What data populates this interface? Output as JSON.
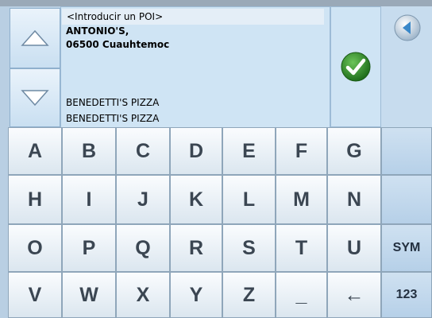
{
  "input": {
    "text": "<Introducir un POI>"
  },
  "results": {
    "highlighted": {
      "line1": "ANTONIO'S,",
      "line2": "06500 Cuauhtemoc"
    },
    "next": {
      "line1": "BENEDETTI'S PIZZA",
      "line2": "BENEDETTI'S PIZZA"
    }
  },
  "keyboard": {
    "rows": [
      [
        "A",
        "B",
        "C",
        "D",
        "E",
        "F",
        "G"
      ],
      [
        "H",
        "I",
        "J",
        "K",
        "L",
        "M",
        "N"
      ],
      [
        "O",
        "P",
        "Q",
        "R",
        "S",
        "T",
        "U"
      ],
      [
        "V",
        "W",
        "X",
        "Y",
        "Z",
        "_",
        "←"
      ]
    ],
    "side_keys": [
      "",
      "",
      "SYM",
      "123"
    ]
  },
  "colors": {
    "accent": "#2f8c2a",
    "panel": "#cfe4f4",
    "background": "#b9cfe3"
  },
  "icons": {
    "up": "up-arrow-icon",
    "down": "down-arrow-icon",
    "confirm": "check-icon",
    "back": "back-arrow-icon"
  }
}
